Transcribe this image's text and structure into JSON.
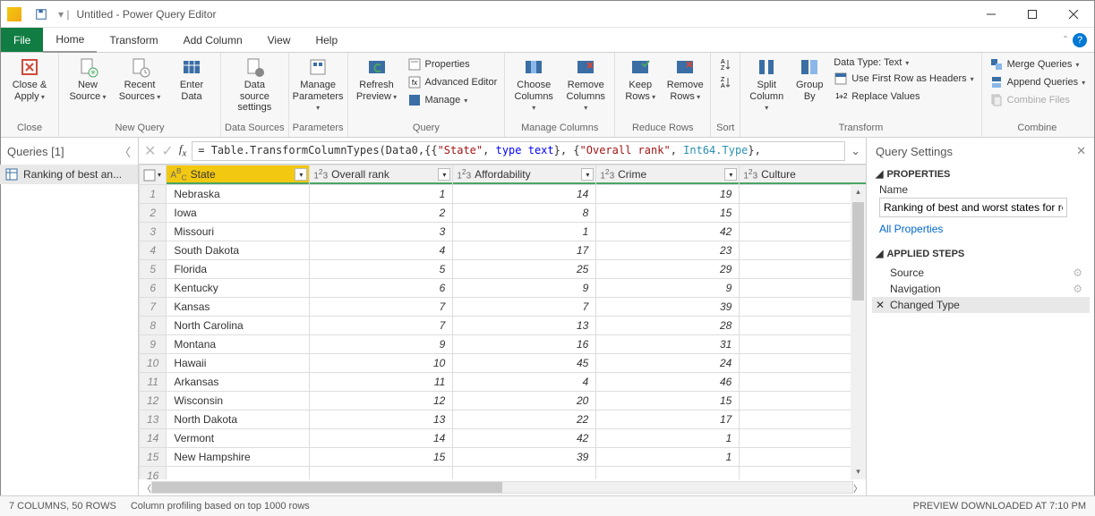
{
  "titlebar": {
    "title": "Untitled - Power Query Editor"
  },
  "menus": {
    "file": "File",
    "home": "Home",
    "transform": "Transform",
    "addcol": "Add Column",
    "view": "View",
    "help": "Help"
  },
  "ribbon": {
    "close_apply": "Close &\nApply",
    "close_group": "Close",
    "new_source": "New\nSource",
    "recent_sources": "Recent\nSources",
    "enter_data": "Enter\nData",
    "new_query": "New Query",
    "ds_settings": "Data source\nsettings",
    "data_sources": "Data Sources",
    "manage_params": "Manage\nParameters",
    "parameters": "Parameters",
    "refresh_preview": "Refresh\nPreview",
    "properties": "Properties",
    "adv_editor": "Advanced Editor",
    "manage": "Manage",
    "query": "Query",
    "choose_cols": "Choose\nColumns",
    "remove_cols": "Remove\nColumns",
    "manage_columns": "Manage Columns",
    "keep_rows": "Keep\nRows",
    "remove_rows": "Remove\nRows",
    "reduce_rows": "Reduce Rows",
    "sort": "Sort",
    "split_col": "Split\nColumn",
    "group_by": "Group\nBy",
    "data_type": "Data Type: Text",
    "first_row": "Use First Row as Headers",
    "replace": "Replace Values",
    "transform": "Transform",
    "merge": "Merge Queries",
    "append": "Append Queries",
    "combine_files": "Combine Files",
    "combine": "Combine"
  },
  "queries": {
    "header": "Queries [1]",
    "item": "Ranking of best an..."
  },
  "formula": {
    "prefix": "= Table.TransformColumnTypes(Data0,{{",
    "s1": "\"State\"",
    "t_text": "type text",
    "mid1": "}, {",
    "s2": "\"Overall rank\"",
    "int": "Int64.Type",
    "suffix": "},"
  },
  "columns": {
    "state": "State",
    "rank": "Overall rank",
    "afford": "Affordability",
    "crime": "Crime",
    "culture": "Culture"
  },
  "rows": [
    {
      "n": 1,
      "state": "Nebraska",
      "rank": 1,
      "aff": 14,
      "crime": 19
    },
    {
      "n": 2,
      "state": "Iowa",
      "rank": 2,
      "aff": 8,
      "crime": 15
    },
    {
      "n": 3,
      "state": "Missouri",
      "rank": 3,
      "aff": 1,
      "crime": 42
    },
    {
      "n": 4,
      "state": "South Dakota",
      "rank": 4,
      "aff": 17,
      "crime": 23
    },
    {
      "n": 5,
      "state": "Florida",
      "rank": 5,
      "aff": 25,
      "crime": 29
    },
    {
      "n": 6,
      "state": "Kentucky",
      "rank": 6,
      "aff": 9,
      "crime": 9
    },
    {
      "n": 7,
      "state": "Kansas",
      "rank": 7,
      "aff": 7,
      "crime": 39
    },
    {
      "n": 8,
      "state": "North Carolina",
      "rank": 7,
      "aff": 13,
      "crime": 28
    },
    {
      "n": 9,
      "state": "Montana",
      "rank": 9,
      "aff": 16,
      "crime": 31
    },
    {
      "n": 10,
      "state": "Hawaii",
      "rank": 10,
      "aff": 45,
      "crime": 24
    },
    {
      "n": 11,
      "state": "Arkansas",
      "rank": 11,
      "aff": 4,
      "crime": 46
    },
    {
      "n": 12,
      "state": "Wisconsin",
      "rank": 12,
      "aff": 20,
      "crime": 15
    },
    {
      "n": 13,
      "state": "North Dakota",
      "rank": 13,
      "aff": 22,
      "crime": 17
    },
    {
      "n": 14,
      "state": "Vermont",
      "rank": 14,
      "aff": 42,
      "crime": 1
    },
    {
      "n": 15,
      "state": "New Hampshire",
      "rank": 15,
      "aff": 39,
      "crime": 1
    }
  ],
  "settings": {
    "header": "Query Settings",
    "properties": "PROPERTIES",
    "name_label": "Name",
    "name_value": "Ranking of best and worst states for retire",
    "all_props": "All Properties",
    "applied_steps": "APPLIED STEPS",
    "steps": {
      "source": "Source",
      "nav": "Navigation",
      "changed": "Changed Type"
    }
  },
  "status": {
    "cols": "7 COLUMNS, 50 ROWS",
    "profiling": "Column profiling based on top 1000 rows",
    "preview": "PREVIEW DOWNLOADED AT 7:10 PM"
  }
}
